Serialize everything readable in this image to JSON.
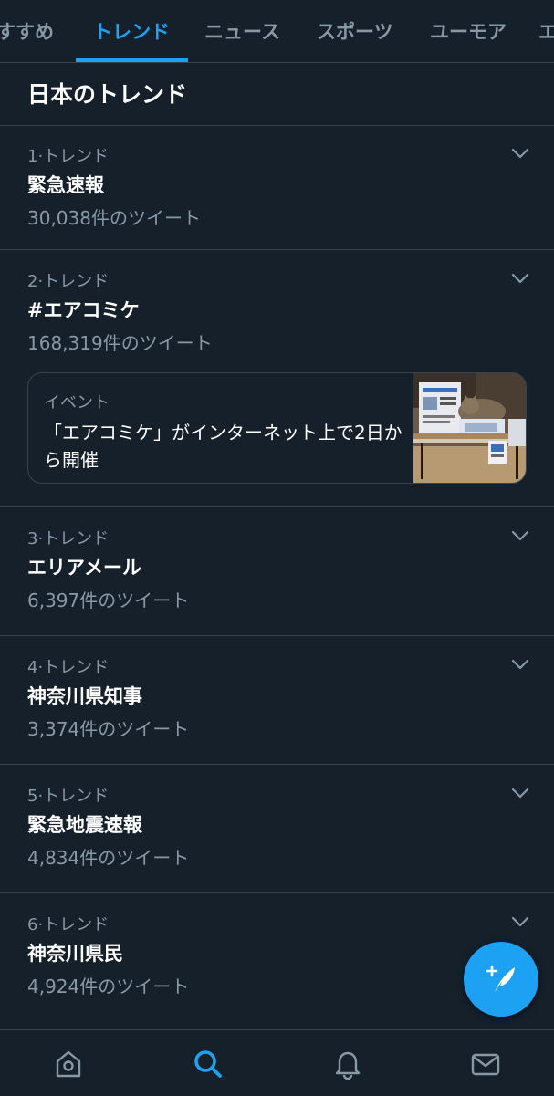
{
  "tabs": [
    {
      "label": "すすめ",
      "active": false
    },
    {
      "label": "トレンド",
      "active": true
    },
    {
      "label": "ニュース",
      "active": false
    },
    {
      "label": "スポーツ",
      "active": false
    },
    {
      "label": "ユーモア",
      "active": false
    },
    {
      "label": "エ",
      "active": false
    }
  ],
  "section_title": "日本のトレンド",
  "trends": [
    {
      "meta": "1·トレンド",
      "name": "緊急速報",
      "count": "30,038件のツイート"
    },
    {
      "meta": "2·トレンド",
      "name": "#エアコミケ",
      "count": "168,319件のツイート"
    },
    {
      "meta": "3·トレンド",
      "name": "エリアメール",
      "count": "6,397件のツイート"
    },
    {
      "meta": "4·トレンド",
      "name": "神奈川県知事",
      "count": "3,374件のツイート"
    },
    {
      "meta": "5·トレンド",
      "name": "緊急地震速報",
      "count": "4,834件のツイート"
    },
    {
      "meta": "6·トレンド",
      "name": "神奈川県民",
      "count": "4,924件のツイート"
    }
  ],
  "event_card": {
    "label": "イベント",
    "title": "「エアコミケ」がインターネット上で2日から開催"
  },
  "icons": {
    "chevron": "chevron-down-icon",
    "compose": "compose-tweet-icon",
    "home": "home-icon",
    "search": "search-icon",
    "notifications": "bell-icon",
    "messages": "mail-icon"
  },
  "colors": {
    "background": "#15202b",
    "accent": "#1da1f2",
    "secondary_text": "#8899a6",
    "divider": "#38444d"
  }
}
